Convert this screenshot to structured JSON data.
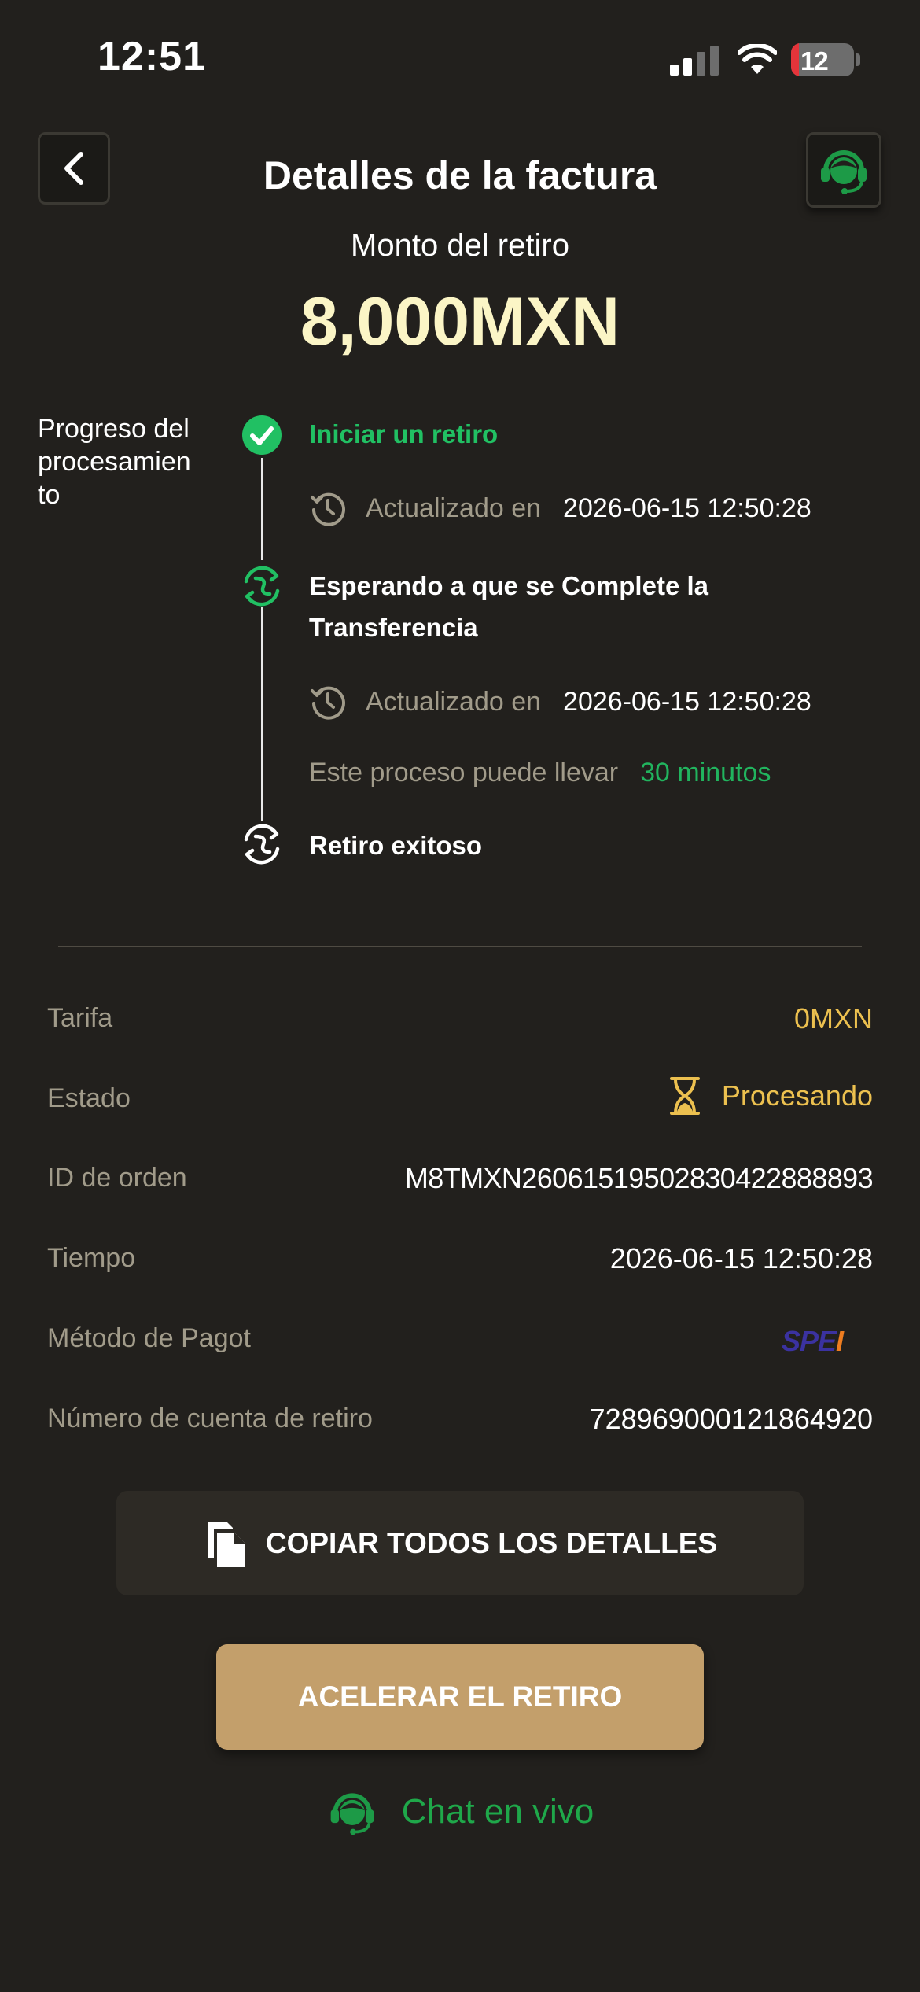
{
  "status_bar": {
    "time": "12:51",
    "battery": "12",
    "battery_level": 0.12
  },
  "header": {
    "title": "Detalles de la factura"
  },
  "amount": {
    "label": "Monto del retiro",
    "value": "8,000MXN"
  },
  "progress": {
    "label": "Progreso del procesamiento",
    "steps": [
      {
        "title": "Iniciar un retiro",
        "updated_label": "Actualizado en",
        "updated_time": "2026-06-15 12:50:28",
        "state": "done"
      },
      {
        "title": "Esperando a que se Complete la Transferencia",
        "updated_label": "Actualizado en",
        "updated_time": "2026-06-15 12:50:28",
        "duration_label": "Este proceso puede llevar",
        "duration_value": "30 minutos",
        "state": "active"
      },
      {
        "title": "Retiro exitoso",
        "state": "pending"
      }
    ]
  },
  "details": {
    "fee": {
      "label": "Tarifa",
      "value": "0MXN"
    },
    "status": {
      "label": "Estado",
      "value": "Procesando"
    },
    "order_id": {
      "label": "ID de orden",
      "value": "M8TMXN26061519502830422888893"
    },
    "time": {
      "label": "Tiempo",
      "value": "2026-06-15 12:50:28"
    },
    "payment_method": {
      "label": "Método de Pagot",
      "logo_part1": "SPE",
      "logo_part2": "I"
    },
    "account": {
      "label": "Número de cuenta de retiro",
      "value": "728969000121864920"
    }
  },
  "actions": {
    "copy_label": "COPIAR TODOS LOS DETALLES",
    "speed_label": "ACELERAR EL RETIRO",
    "chat_label": "Chat en vivo"
  },
  "colors": {
    "background": "#22201d",
    "accent_green": "#21c063",
    "gold": "#ecc04f",
    "amount": "#fbf5c6",
    "primary_button": "#c39f6b"
  },
  "icons": {
    "back": "chevron-left-icon",
    "support": "headset-agent-icon",
    "step_done": "check-circle-icon",
    "step_active": "processing-arrows-icon",
    "clock": "clock-history-icon",
    "status": "hourglass-icon",
    "copy": "copy-documents-icon",
    "chat": "headset-agent-icon"
  }
}
